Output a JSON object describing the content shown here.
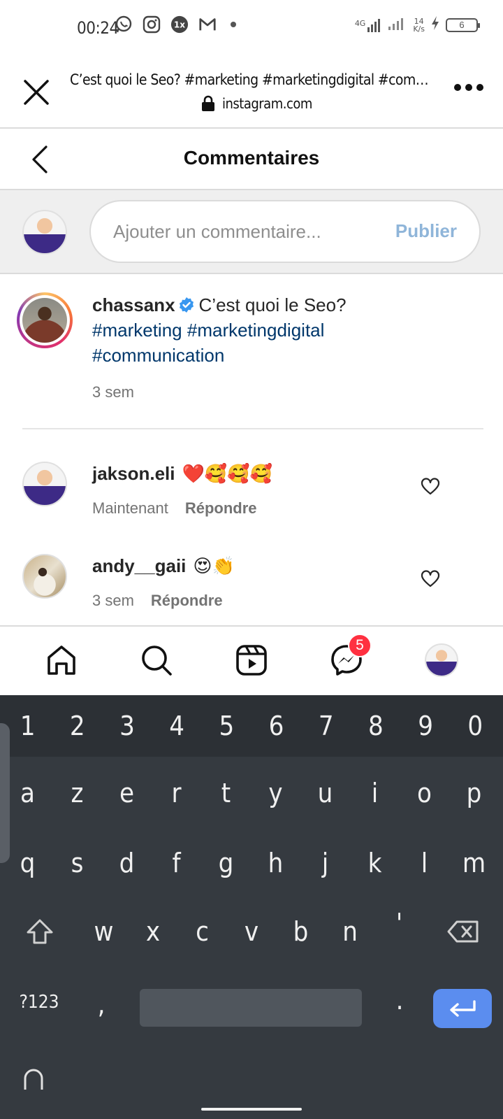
{
  "status_bar": {
    "time": "00:24",
    "network": "4G",
    "speed_value": "14",
    "speed_unit": "K/s",
    "battery": "6"
  },
  "browser": {
    "page_title": "C’est quoi le Seo? #marketing #marketingdigital #communica...",
    "url": "instagram.com"
  },
  "header": {
    "title": "Commentaires"
  },
  "composer": {
    "placeholder": "Ajouter un commentaire...",
    "publish_label": "Publier"
  },
  "post": {
    "username": "chassanx",
    "caption_text": "C’est quoi le Seo?",
    "hashtags": [
      "#marketing",
      "#marketingdigital",
      "#communication"
    ],
    "time": "3 sem"
  },
  "comments": [
    {
      "username": "jakson.eli",
      "emojis": "❤️🥰🥰🥰",
      "time": "Maintenant",
      "reply_label": "Répondre"
    },
    {
      "username": "andy__gaii",
      "emojis": "😍👏",
      "time": "3 sem",
      "reply_label": "Répondre"
    }
  ],
  "nav": {
    "messages_badge": "5"
  },
  "keyboard": {
    "numbers": [
      "1",
      "2",
      "3",
      "4",
      "5",
      "6",
      "7",
      "8",
      "9",
      "0"
    ],
    "row1": [
      "a",
      "z",
      "e",
      "r",
      "t",
      "y",
      "u",
      "i",
      "o",
      "p"
    ],
    "row2": [
      "q",
      "s",
      "d",
      "f",
      "g",
      "h",
      "j",
      "k",
      "l",
      "m"
    ],
    "row3": [
      "w",
      "x",
      "c",
      "v",
      "b",
      "n",
      "'"
    ],
    "symbols_label": "?123",
    "comma": ",",
    "period": "."
  },
  "colors": {
    "link_blue": "#00376b",
    "publish_disabled": "#8fb5d9",
    "badge_red": "#ff3040",
    "keyboard_bg": "#353a40",
    "enter_blue": "#5b8def"
  }
}
